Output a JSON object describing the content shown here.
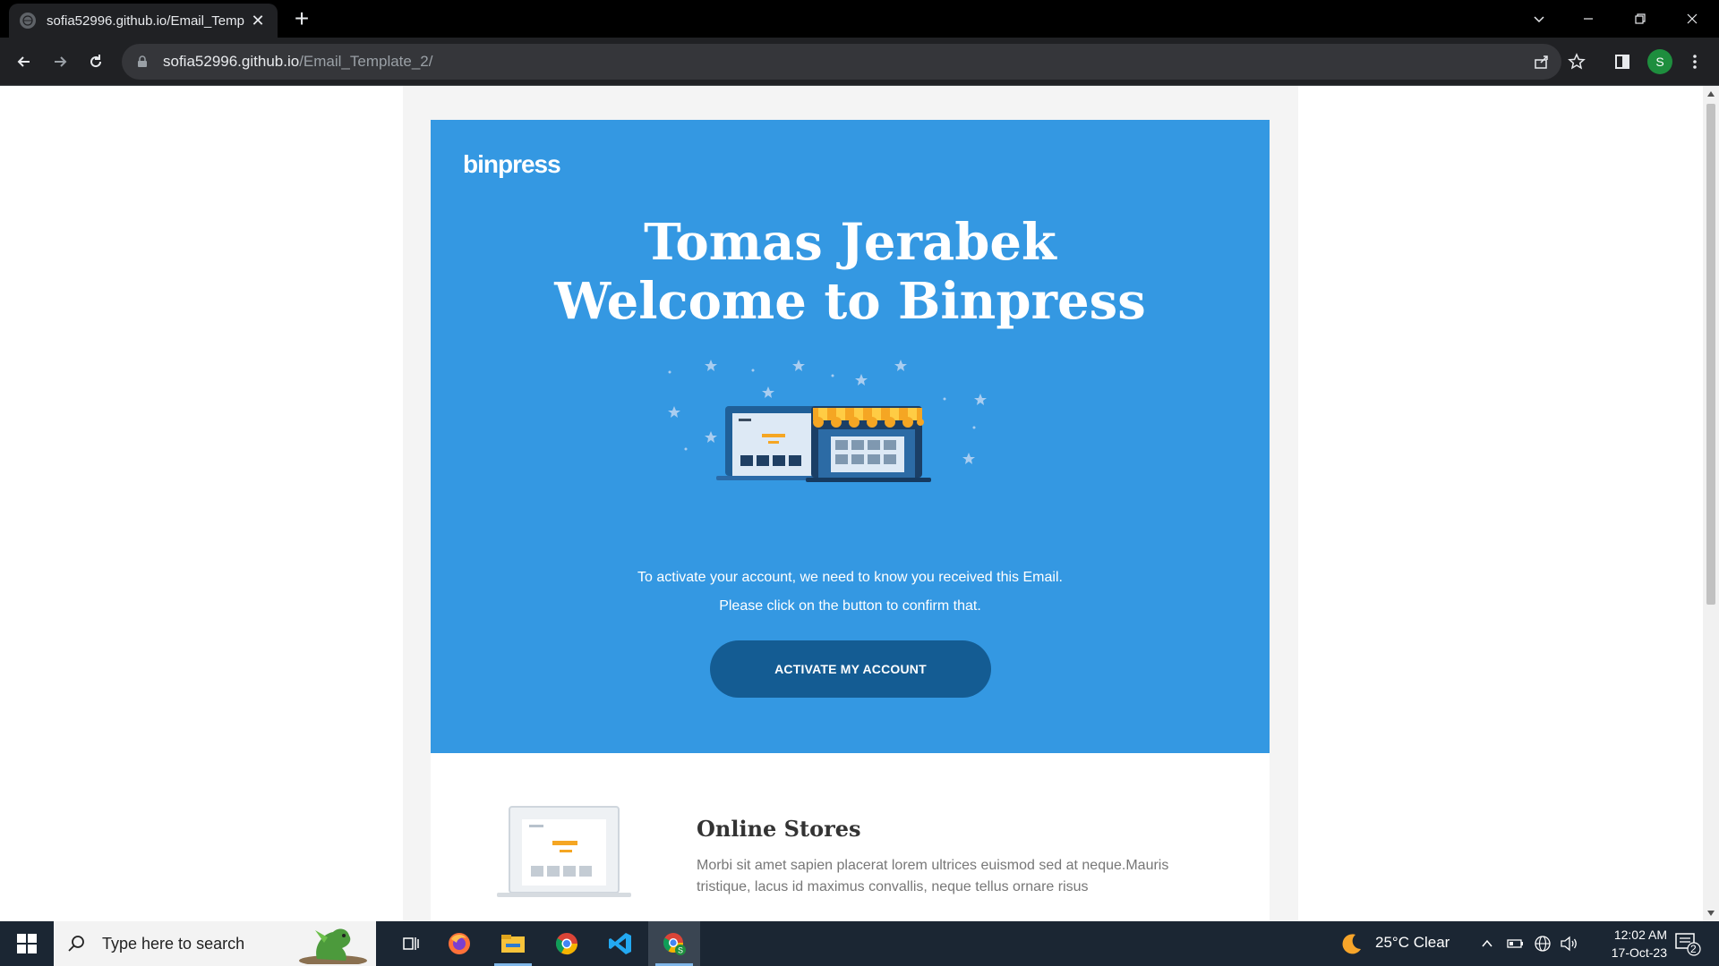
{
  "browser": {
    "tab_title": "sofia52996.github.io/Email_Temp",
    "url_host": "sofia52996.github.io",
    "url_path": "/Email_Template_2/",
    "profile_initial": "S"
  },
  "email": {
    "logo": "binpress",
    "title_line1": "Tomas Jerabek",
    "title_line2": "Welcome to Binpress",
    "text_line1": "To activate your account, we need to know you received this Email.",
    "text_line2": "Please click on the button to confirm that.",
    "cta_label": "ACTIVATE MY ACCOUNT",
    "feature": {
      "title": "Online Stores",
      "text": "Morbi sit amet sapien placerat lorem ultrices euismod sed at neque.Mauris tristique, lacus id maximus convallis, neque tellus ornare risus"
    },
    "colors": {
      "hero_bg": "#3498e2",
      "cta_bg": "#145c93",
      "awning_orange": "#f5a623"
    }
  },
  "taskbar": {
    "search_placeholder": "Type here to search",
    "weather": "25°C  Clear",
    "time": "12:02 AM",
    "date": "17-Oct-23",
    "notification_count": "2"
  }
}
